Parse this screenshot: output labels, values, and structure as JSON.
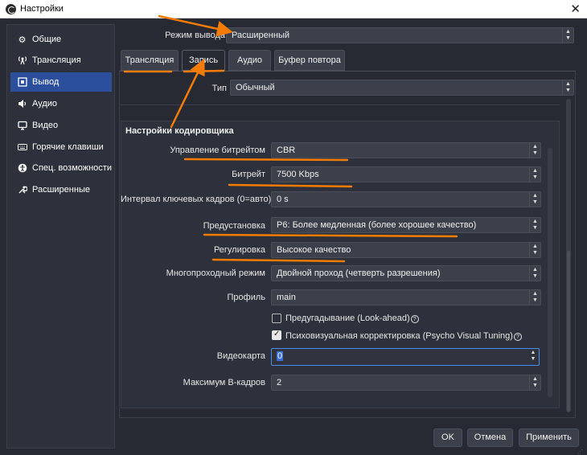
{
  "window": {
    "title": "Настройки",
    "close": "✕"
  },
  "sidebar": {
    "items": [
      {
        "label": "Общие",
        "icon": "gear-icon",
        "glyph": "⚙"
      },
      {
        "label": "Трансляция",
        "icon": "antenna-icon",
        "glyph": "ᵠ"
      },
      {
        "label": "Вывод",
        "icon": "output-icon",
        "glyph": "▣"
      },
      {
        "label": "Аудио",
        "icon": "speaker-icon",
        "glyph": "◀"
      },
      {
        "label": "Видео",
        "icon": "monitor-icon",
        "glyph": "▭"
      },
      {
        "label": "Горячие клавиши",
        "icon": "keyboard-icon",
        "glyph": "⌨"
      },
      {
        "label": "Спец. возможности",
        "icon": "accessibility-icon",
        "glyph": "✿"
      },
      {
        "label": "Расширенные",
        "icon": "wrench-icon",
        "glyph": "✲"
      }
    ],
    "active_index": 2
  },
  "output_mode": {
    "label": "Режим вывода",
    "value": "Расширенный"
  },
  "tabs": [
    {
      "label": "Трансляция"
    },
    {
      "label": "Запись"
    },
    {
      "label": "Аудио"
    },
    {
      "label": "Буфер повтора"
    }
  ],
  "active_tab": "Запись",
  "type_row": {
    "label": "Тип",
    "value": "Обычный"
  },
  "encoder": {
    "title": "Настройки кодировщика",
    "rate_control": {
      "label": "Управление битрейтом",
      "value": "CBR"
    },
    "bitrate": {
      "label": "Битрейт",
      "value": "7500 Kbps"
    },
    "keyframe": {
      "label": "Интервал ключевых кадров (0=авто)",
      "value": "0 s"
    },
    "preset": {
      "label": "Предустановка",
      "value": "P6: Более медленная (более хорошее качество)"
    },
    "tuning": {
      "label": "Регулировка",
      "value": "Высокое качество"
    },
    "multipass": {
      "label": "Многопроходный режим",
      "value": "Двойной проход (четверть разрешения)"
    },
    "profile": {
      "label": "Профиль",
      "value": "main"
    },
    "lookahead": {
      "label": "Предугадывание (Look-ahead)",
      "checked": false
    },
    "psycho": {
      "label": "Психовизуальная корректировка (Psycho Visual Tuning)",
      "checked": true
    },
    "gpu": {
      "label": "Видеокарта",
      "value": "0"
    },
    "bframes": {
      "label": "Максимум B-кадров",
      "value": "2"
    }
  },
  "buttons": {
    "ok": "OK",
    "cancel": "Отмена",
    "apply": "Применить"
  },
  "colors": {
    "background": "#272a33",
    "active": "#2b4f9c",
    "annotation": "#f57c00",
    "focus": "#4a8cf7"
  }
}
